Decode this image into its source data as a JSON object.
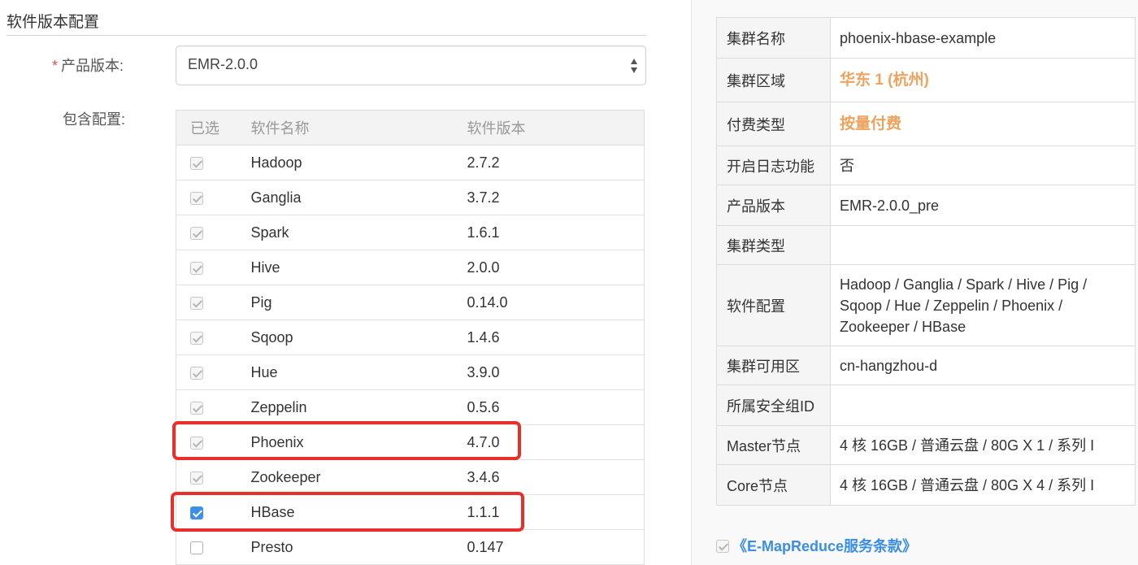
{
  "section": {
    "title": "软件版本配置"
  },
  "form": {
    "required_mark": "*",
    "version_label": "产品版本:",
    "version_value": "EMR-2.0.0",
    "components_label": "包含配置:"
  },
  "software_table": {
    "headers": [
      "已选",
      "软件名称",
      "软件版本"
    ],
    "rows": [
      {
        "name": "Hadoop",
        "version": "2.7.2"
      },
      {
        "name": "Ganglia",
        "version": "3.7.2"
      },
      {
        "name": "Spark",
        "version": "1.6.1"
      },
      {
        "name": "Hive",
        "version": "2.0.0"
      },
      {
        "name": "Pig",
        "version": "0.14.0"
      },
      {
        "name": "Sqoop",
        "version": "1.4.6"
      },
      {
        "name": "Hue",
        "version": "3.9.0"
      },
      {
        "name": "Zeppelin",
        "version": "0.5.6"
      },
      {
        "name": "Phoenix",
        "version": "4.7.0"
      },
      {
        "name": "Zookeeper",
        "version": "3.4.6"
      },
      {
        "name": "HBase",
        "version": "1.1.1"
      },
      {
        "name": "Presto",
        "version": "0.147"
      }
    ]
  },
  "summary": {
    "rows": [
      {
        "key": "集群名称",
        "value": "phoenix-hbase-example"
      },
      {
        "key": "集群区域",
        "value": "华东 1 (杭州)"
      },
      {
        "key": "付费类型",
        "value": "按量付费"
      },
      {
        "key": "开启日志功能",
        "value": "否"
      },
      {
        "key": "产品版本",
        "value": "EMR-2.0.0_pre"
      },
      {
        "key": "集群类型",
        "value": ""
      },
      {
        "key": "软件配置",
        "value": "Hadoop / Ganglia / Spark / Hive / Pig / Sqoop / Hue / Zeppelin / Phoenix / Zookeeper / HBase"
      },
      {
        "key": "集群可用区",
        "value": "cn-hangzhou-d"
      },
      {
        "key": "所属安全组ID",
        "value": ""
      },
      {
        "key": "Master节点",
        "value": "4 核 16GB / 普通云盘 / 80G X 1 / 系列 I"
      },
      {
        "key": "Core节点",
        "value": "4 核 16GB / 普通云盘 / 80G X 4 / 系列 I"
      }
    ]
  },
  "terms": {
    "link_text": "《E-MapReduce服务条款》"
  },
  "colors": {
    "accent": "#f0a25c",
    "link": "#3a8ee6",
    "highlight": "#e8302a",
    "checked": "#3e8fe8"
  }
}
